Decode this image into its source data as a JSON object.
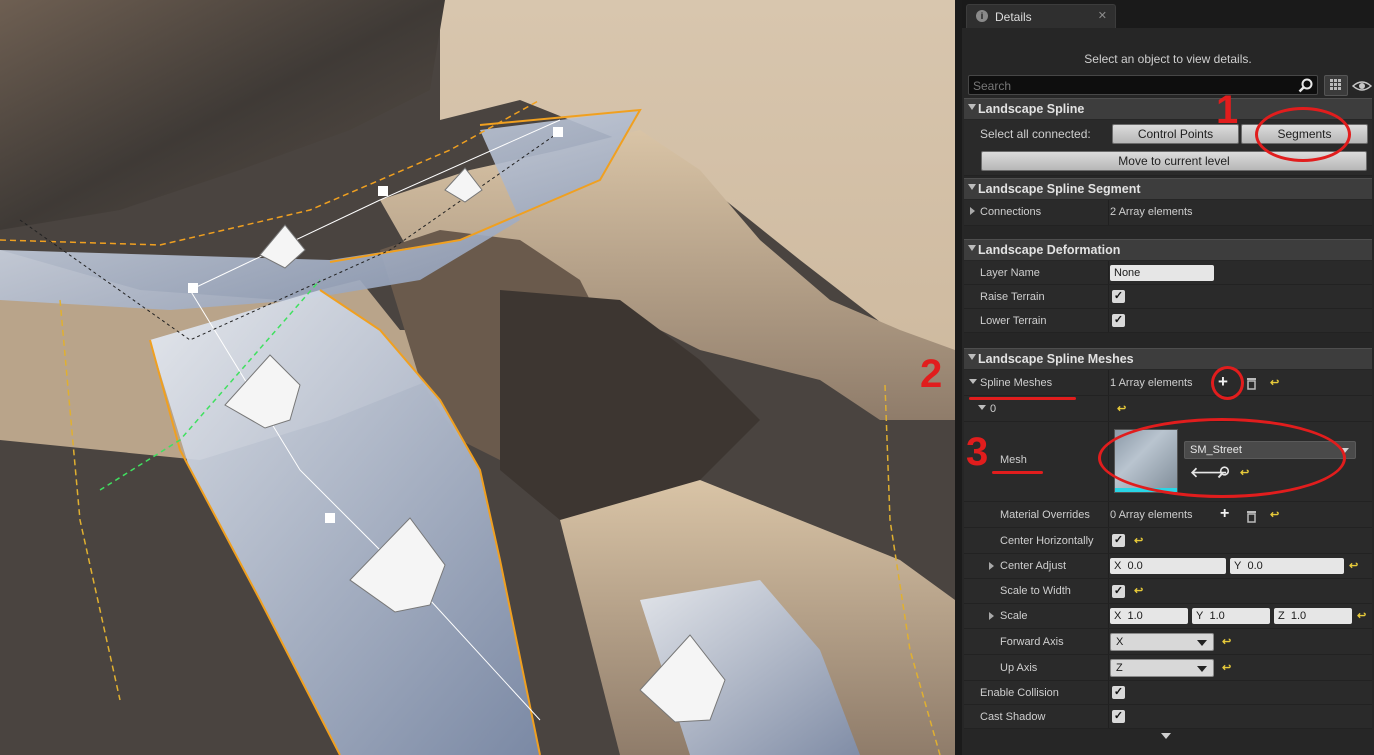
{
  "details_tab": {
    "title": "Details",
    "close": "✕"
  },
  "hint": "Select an object to view details.",
  "search": {
    "placeholder": "Search"
  },
  "landscape_spline": {
    "title": "Landscape Spline",
    "select_all_label": "Select all connected:",
    "control_points_button": "Control Points",
    "segments_button": "Segments",
    "move_button": "Move to current level"
  },
  "segment": {
    "title": "Landscape Spline Segment",
    "connections_label": "Connections",
    "connections_value": "2 Array elements"
  },
  "deformation": {
    "title": "Landscape Deformation",
    "layer_name_label": "Layer Name",
    "layer_name_value": "None",
    "raise_label": "Raise Terrain",
    "raise_checked": true,
    "lower_label": "Lower Terrain",
    "lower_checked": true
  },
  "meshes": {
    "title": "Landscape Spline Meshes",
    "spline_meshes_label": "Spline Meshes",
    "spline_meshes_value": "1 Array elements",
    "index_label": "0",
    "mesh_label": "Mesh",
    "mesh_value": "SM_Street",
    "material_overrides_label": "Material Overrides",
    "material_overrides_value": "0 Array elements",
    "center_horizontally_label": "Center Horizontally",
    "center_adjust_label": "Center Adjust",
    "center_adjust": {
      "x_label": "X",
      "x": "0.0",
      "y_label": "Y",
      "y": "0.0"
    },
    "scale_to_width_label": "Scale to Width",
    "scale_label": "Scale",
    "scale": {
      "x_label": "X",
      "x": "1.0",
      "y_label": "Y",
      "y": "1.0",
      "z_label": "Z",
      "z": "1.0"
    },
    "forward_axis_label": "Forward Axis",
    "forward_axis_value": "X",
    "up_axis_label": "Up Axis",
    "up_axis_value": "Z",
    "enable_collision_label": "Enable Collision",
    "cast_shadow_label": "Cast Shadow"
  },
  "annotations": {
    "one": "1",
    "two": "2",
    "three": "3"
  },
  "colors": {
    "annotation_red": "#e11d1d",
    "reset_yellow": "#e6c93a",
    "spline_orange": "#f0a020",
    "panel_bg": "#262626"
  }
}
